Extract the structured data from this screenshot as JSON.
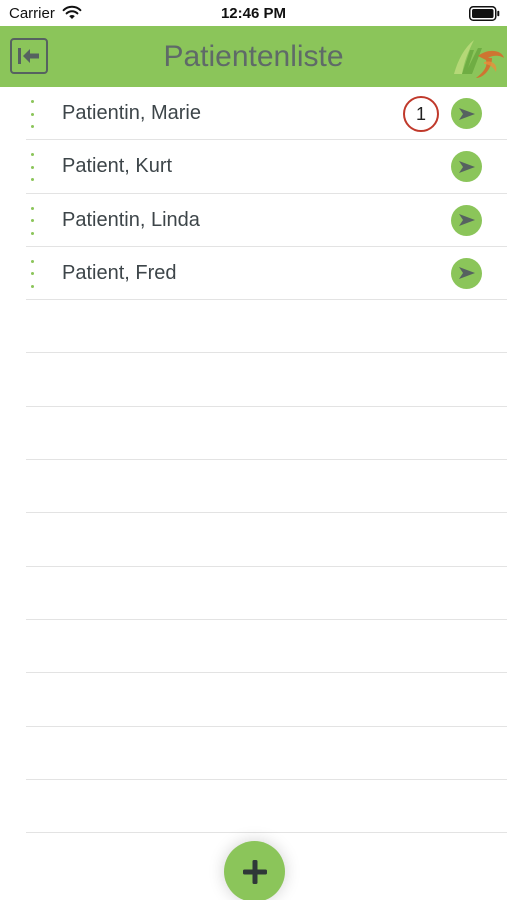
{
  "status_bar": {
    "carrier": "Carrier",
    "time": "12:46 PM",
    "wifi_icon": "wifi-icon",
    "battery_icon": "battery-icon"
  },
  "header": {
    "title": "Patientenliste",
    "back_icon": "back-arrow-icon",
    "logo_icon": "app-logo"
  },
  "patients": [
    {
      "name": "Patientin, Marie",
      "badge": "1"
    },
    {
      "name": "Patient, Kurt"
    },
    {
      "name": "Patientin, Linda"
    },
    {
      "name": "Patient, Fred"
    }
  ],
  "fab": {
    "icon": "plus-icon"
  },
  "colors": {
    "accent": "#8bc55a",
    "title_text": "#5f6a68",
    "badge_border": "#c0392b",
    "icon_dark": "#566260"
  }
}
